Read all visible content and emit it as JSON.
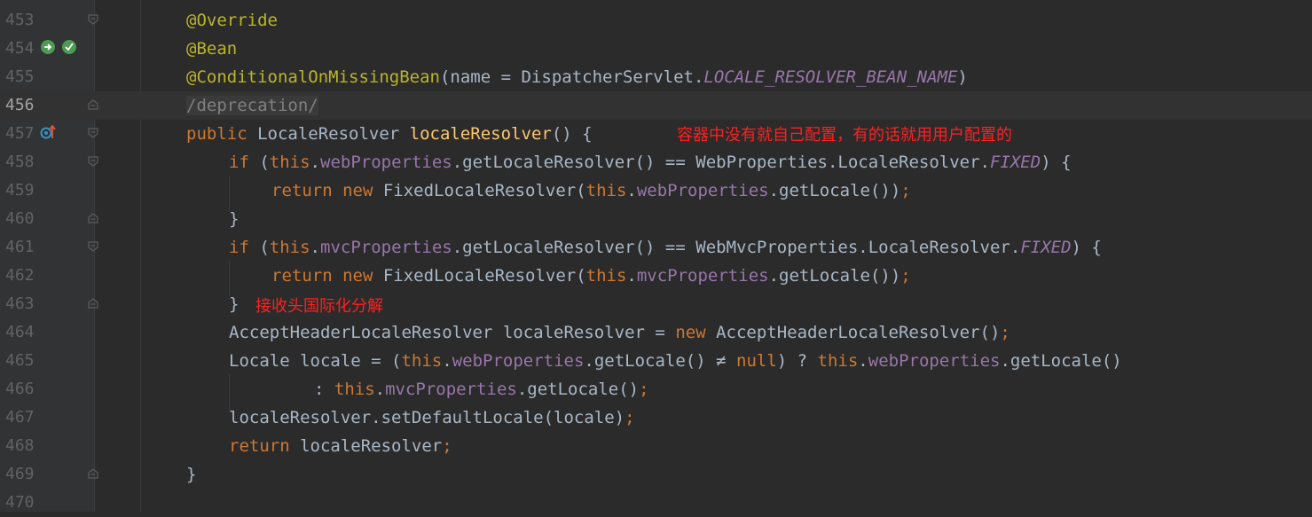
{
  "editor": {
    "lines": [
      {
        "n": "453",
        "code": "ann",
        "text": "@Override"
      },
      {
        "n": "454",
        "code": "ann",
        "text": "@Bean"
      },
      {
        "n": "455",
        "text": "@ConditionalOnMissingBean(name = DispatcherServlet.LOCALE_RESOLVER_BEAN_NAME)"
      },
      {
        "n": "456",
        "text": "/deprecation/"
      },
      {
        "n": "457",
        "text": "public LocaleResolver localeResolver() {"
      },
      {
        "n": "458",
        "text": "if (this.webProperties.getLocaleResolver() == WebProperties.LocaleResolver.FIXED) {"
      },
      {
        "n": "459",
        "text": "return new FixedLocaleResolver(this.webProperties.getLocale());"
      },
      {
        "n": "460",
        "text": "}"
      },
      {
        "n": "461",
        "text": "if (this.mvcProperties.getLocaleResolver() == WebMvcProperties.LocaleResolver.FIXED) {"
      },
      {
        "n": "462",
        "text": "return new FixedLocaleResolver(this.mvcProperties.getLocale());"
      },
      {
        "n": "463",
        "text": "}"
      },
      {
        "n": "464",
        "text": "AcceptHeaderLocaleResolver localeResolver = new AcceptHeaderLocaleResolver();"
      },
      {
        "n": "465",
        "text": "Locale locale = (this.webProperties.getLocale() ≠ null) ? this.webProperties.getLocale()"
      },
      {
        "n": "466",
        "text": ": this.mvcProperties.getLocale();"
      },
      {
        "n": "467",
        "text": "localeResolver.setDefaultLocale(locale);"
      },
      {
        "n": "468",
        "text": "return localeResolver;"
      },
      {
        "n": "469",
        "text": "}"
      },
      {
        "n": "470",
        "text": ""
      }
    ],
    "current_line": "456"
  },
  "annotations": {
    "note_1": "容器中没有就自己配置，有的话就用用户配置的",
    "note_2": "接收头国际化分解"
  },
  "tokens": {
    "override": "@Override",
    "bean": "@Bean",
    "cond_ann": "@ConditionalOnMissingBean",
    "cond_rest1": "(name = DispatcherServlet.",
    "cond_const": "LOCALE_RESOLVER_BEAN_NAME",
    "cond_rest2": ")",
    "deprecation": "/deprecation/",
    "public_kw": "public",
    "resolver_type": " LocaleResolver ",
    "method_name": "localeResolver",
    "method_tail": "() {",
    "if_kw": "if",
    "paren_open": " (",
    "this_kw": "this",
    "dot": ".",
    "web_props": "webProperties",
    "mvc_props": "mvcProperties",
    "get_resolver_eq_web": ".getLocaleResolver() == WebProperties.LocaleResolver.",
    "get_resolver_eq_mvc": ".getLocaleResolver() == WebMvcProperties.LocaleResolver.",
    "fixed": "FIXED",
    "close_brace_open": ") {",
    "return_kw": "return",
    "new_kw": "new",
    "fixed_resolver": " FixedLocaleResolver(",
    "get_locale_close": ".getLocale())",
    "semi": ";",
    "close_brace": "}",
    "accept_decl": "AcceptHeaderLocaleResolver localeResolver = ",
    "accept_ctor": " AcceptHeaderLocaleResolver()",
    "locale_decl": "Locale locale = (",
    "get_locale_neq": ".getLocale() ≠ ",
    "null_kw": "null",
    "ternary": ") ? ",
    "get_locale": ".getLocale()",
    "colon": ": ",
    "set_default": "localeResolver.setDefaultLocale(locale)",
    "return_resolver": " localeResolver"
  },
  "colors": {
    "background": "#2b2b2b",
    "gutter": "#313335",
    "keyword": "#cc7832",
    "annotation": "#bbb529",
    "field": "#9876aa",
    "method_decl": "#ffc66d",
    "default_text": "#a9b7c6",
    "line_number": "#606366",
    "note": "#ff2020"
  },
  "icons": [
    "override-implement-icon",
    "bean-icon",
    "implemented-method-icon",
    "fold-marker-icon"
  ]
}
